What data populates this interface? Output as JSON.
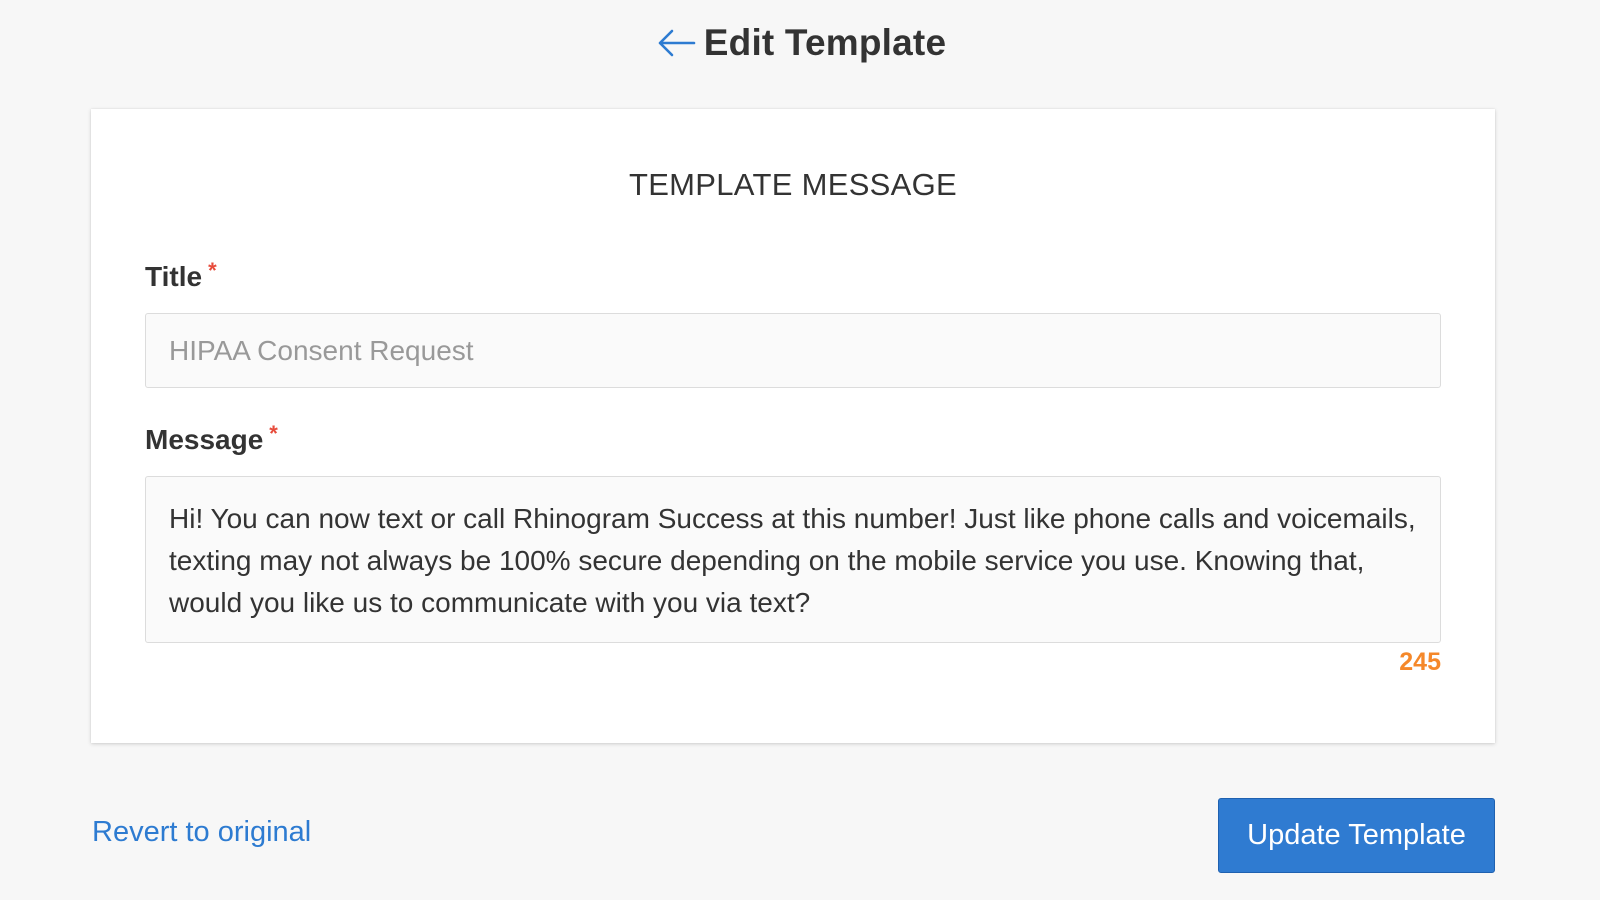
{
  "header": {
    "title": "Edit Template",
    "back_icon": "arrow-left-icon"
  },
  "card": {
    "heading": "TEMPLATE MESSAGE",
    "title_field": {
      "label": "Title",
      "required_mark": "*",
      "value": "HIPAA Consent Request"
    },
    "message_field": {
      "label": "Message",
      "required_mark": "*",
      "value": "Hi! You can now text or call Rhinogram Success at this number! Just like phone calls and voicemails, texting may not always be 100% secure depending on the mobile service you use. Knowing that, would you like us to communicate with you via text?",
      "char_count": "245"
    }
  },
  "footer": {
    "revert_label": "Revert to original",
    "submit_label": "Update Template"
  },
  "colors": {
    "accent": "#2f7bd1",
    "required": "#e74c3c",
    "counter": "#f5882a",
    "background": "#f7f7f7"
  }
}
